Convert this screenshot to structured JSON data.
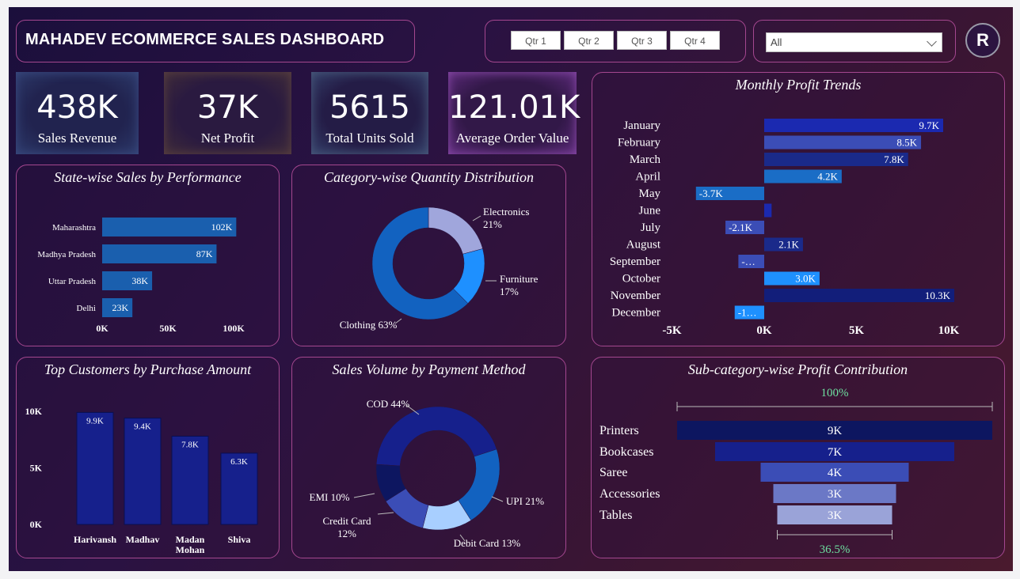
{
  "header": {
    "title": "MAHADEV ECOMMERCE SALES DASHBOARD",
    "quarters": [
      "Qtr 1",
      "Qtr 2",
      "Qtr 3",
      "Qtr 4"
    ],
    "filter_value": "All",
    "avatar_letter": "R"
  },
  "kpis": [
    {
      "value": "438K",
      "label": "Sales Revenue"
    },
    {
      "value": "37K",
      "label": "Net Profit"
    },
    {
      "value": "5615",
      "label": "Total Units Sold"
    },
    {
      "value": "121.01K",
      "label": "Average Order Value"
    }
  ],
  "colors": {
    "accent_border": "#a4478f",
    "bar_blue": "#1a63b7",
    "bar_navy": "#16208c",
    "green_text": "#6ee0a0"
  },
  "chart_data": [
    {
      "id": "state",
      "type": "bar",
      "orientation": "horizontal",
      "title": "State-wise Sales by Performance",
      "categories": [
        "Maharashtra",
        "Madhya Pradesh",
        "Uttar Pradesh",
        "Delhi"
      ],
      "values": [
        102,
        87,
        38,
        23
      ],
      "labels": [
        "102K",
        "87K",
        "38K",
        "23K"
      ],
      "xticks": [
        "0K",
        "50K",
        "100K"
      ],
      "xlim": [
        0,
        100
      ]
    },
    {
      "id": "category",
      "type": "pie",
      "title": "Category-wise Quantity Distribution",
      "categories": [
        "Electronics",
        "Furniture",
        "Clothing"
      ],
      "values": [
        21,
        17,
        63
      ],
      "labels": [
        "Electronics\n21%",
        "Furniture\n17%",
        "Clothing 63%"
      ],
      "colors": [
        "#a0a6dc",
        "#1e90ff",
        "#1262c0"
      ]
    },
    {
      "id": "monthly",
      "type": "bar",
      "orientation": "horizontal",
      "title": "Monthly Profit Trends",
      "categories": [
        "January",
        "February",
        "March",
        "April",
        "May",
        "June",
        "July",
        "August",
        "September",
        "October",
        "November",
        "December"
      ],
      "values": [
        9.7,
        8.5,
        7.8,
        4.2,
        -3.7,
        0.4,
        -2.1,
        2.1,
        -1.4,
        3.0,
        10.3,
        -1.6
      ],
      "labels": [
        "9.7K",
        "8.5K",
        "7.8K",
        "4.2K",
        "-3.7K",
        "",
        "-2.1K",
        "2.1K",
        "-…",
        "3.0K",
        "10.3K",
        "-1…"
      ],
      "xticks": [
        "-5K",
        "0K",
        "5K",
        "10K"
      ],
      "xlim": [
        -5,
        10
      ],
      "colors": [
        "#1b29b0",
        "#3b4db6",
        "#1a2a8a",
        "#1a6dc6",
        "#1a6dc6",
        "#1b29b0",
        "#3b4db6",
        "#1a2a8a",
        "#3b4db6",
        "#1e90ff",
        "#121e7a",
        "#1e90ff"
      ]
    },
    {
      "id": "customers",
      "type": "bar",
      "title": "Top Customers by Purchase Amount",
      "categories": [
        "Harivansh",
        "Madhav",
        "Madan Mohan",
        "Shiva"
      ],
      "values": [
        9.9,
        9.4,
        7.8,
        6.3
      ],
      "labels": [
        "9.9K",
        "9.4K",
        "7.8K",
        "6.3K"
      ],
      "yticks": [
        "0K",
        "5K",
        "10K"
      ],
      "ylim": [
        0,
        10
      ]
    },
    {
      "id": "payment",
      "type": "pie",
      "title": "Sales Volume by Payment Method",
      "categories": [
        "COD",
        "UPI",
        "Debit Card",
        "Credit Card",
        "EMI"
      ],
      "values": [
        44,
        21,
        13,
        12,
        10
      ],
      "labels": [
        "COD 44%",
        "UPI 21%",
        "Debit Card 13%",
        "Credit Card\n12%",
        "EMI 10%"
      ],
      "colors": [
        "#16208c",
        "#1262c0",
        "#a8cfff",
        "#3b4db6",
        "#0d1660"
      ]
    },
    {
      "id": "subcat",
      "type": "bar",
      "orientation": "horizontal",
      "title": "Sub-category-wise Profit Contribution",
      "categories": [
        "Printers",
        "Bookcases",
        "Saree",
        "Accessories",
        "Tables"
      ],
      "values": [
        9,
        7,
        4,
        3,
        3
      ],
      "labels": [
        "9K",
        "7K",
        "4K",
        "3K",
        "3K"
      ],
      "top_pct": "100%",
      "bottom_pct": "36.5%",
      "colors": [
        "#0d1660",
        "#16208c",
        "#3b4db6",
        "#6b78c6",
        "#9aa3d8"
      ]
    }
  ]
}
